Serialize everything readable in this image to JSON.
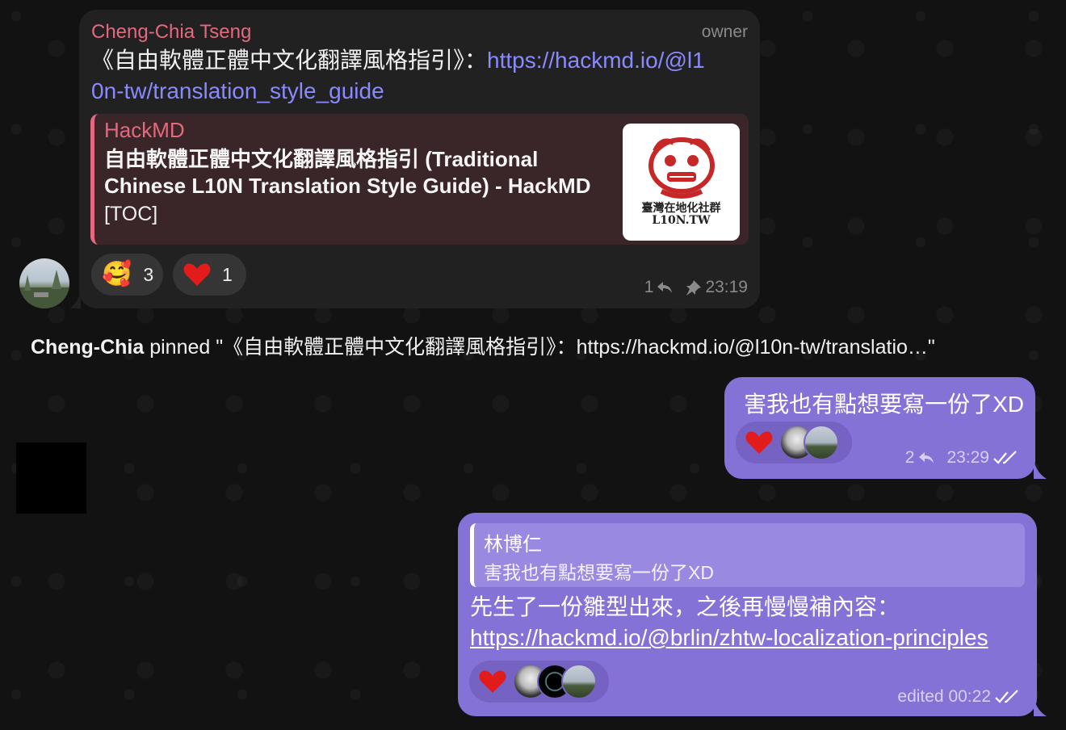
{
  "incoming": {
    "sender": "Cheng-Chia Tseng",
    "role": "owner",
    "text_prefix": "《自由軟體正體中文化翻譯風格指引》：",
    "text_link_line1": "https://hackmd.io/@l1",
    "text_link_line2": "0n-tw/translation_style_guide",
    "preview": {
      "site": "HackMD",
      "title": "自由軟體正體中文化翻譯風格指引 (Traditional Chinese L10N Translation Style Guide) - HackMD",
      "description": "[TOC]",
      "thumb_text_line1": "臺灣在地化社群",
      "thumb_text_line2": "L10N.TW"
    },
    "reactions": [
      {
        "emoji": "🥰",
        "count": "3"
      },
      {
        "emoji": "❤️",
        "count": "1"
      }
    ],
    "replies": "1",
    "time": "23:19",
    "pinned_icon": "pin-icon",
    "reply_icon": "reply-icon"
  },
  "service": {
    "actor": "Cheng-Chia",
    "action": " pinned \"《自由軟體正體中文化翻譯風格指引》：https://hackmd.io/@l10n-tw/translatio…\""
  },
  "outgoing1": {
    "text": "害我也有點想要寫一份了XD",
    "reaction_emoji": "❤️",
    "replies": "2",
    "time": "23:29",
    "status_icon": "double-check-icon"
  },
  "outgoing2": {
    "quote_name": "林博仁",
    "quote_text": "害我也有點想要寫一份了XD",
    "text": "先生了一份雛型出來，之後再慢慢補內容：",
    "link": "https://hackmd.io/@brlin/zhtw-localization-principles",
    "reaction_emoji": "❤️",
    "time_label": "edited 00:22",
    "status_icon": "double-check-icon"
  },
  "colors": {
    "background": "#121212",
    "incoming_bubble": "#212121",
    "outgoing_bubble": "#8572d7",
    "accent_name": "#e4697d",
    "link": "#8a8aff"
  }
}
